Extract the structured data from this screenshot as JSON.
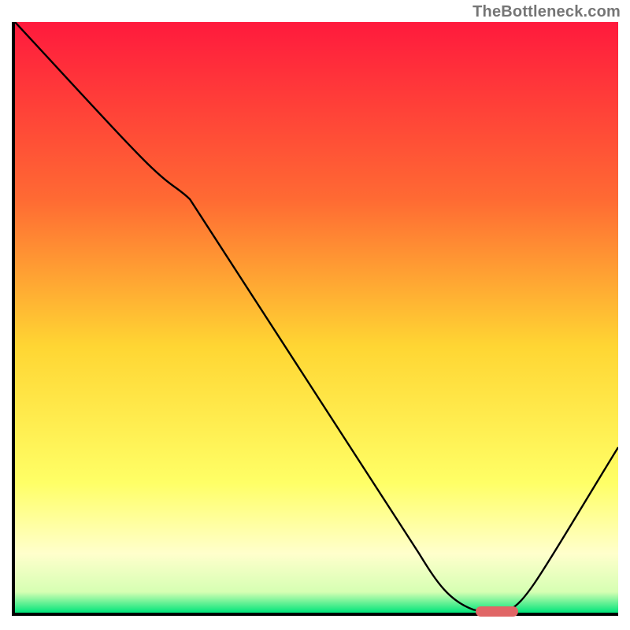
{
  "watermark": "TheBottleneck.com",
  "colors": {
    "gradient_top": "#ff1a3d",
    "gradient_mid1": "#ff7a33",
    "gradient_mid2": "#ffd633",
    "gradient_mid3": "#ffff66",
    "gradient_mid4": "#ffffcc",
    "gradient_bottom": "#00e57a",
    "curve": "#000000",
    "marker": "#e06666",
    "axis": "#000000"
  },
  "chart_data": {
    "type": "line",
    "title": "",
    "xlabel": "",
    "ylabel": "",
    "xlim": [
      0,
      100
    ],
    "ylim": [
      0,
      100
    ],
    "series": [
      {
        "name": "bottleneck-curve",
        "x": [
          0,
          22,
          29,
          70,
          78,
          82,
          100
        ],
        "values": [
          100,
          76,
          70,
          5,
          0,
          0,
          28
        ]
      }
    ],
    "annotations": [
      {
        "name": "optimal-marker",
        "x_range": [
          76,
          83
        ],
        "y": 0.8
      }
    ],
    "background_gradient_stops": [
      {
        "offset": 0.0,
        "color": "#ff1a3d"
      },
      {
        "offset": 0.3,
        "color": "#ff6a33"
      },
      {
        "offset": 0.55,
        "color": "#ffd633"
      },
      {
        "offset": 0.78,
        "color": "#ffff66"
      },
      {
        "offset": 0.9,
        "color": "#ffffcc"
      },
      {
        "offset": 0.965,
        "color": "#d6ffb3"
      },
      {
        "offset": 1.0,
        "color": "#00e57a"
      }
    ],
    "grid": false,
    "legend": false
  }
}
